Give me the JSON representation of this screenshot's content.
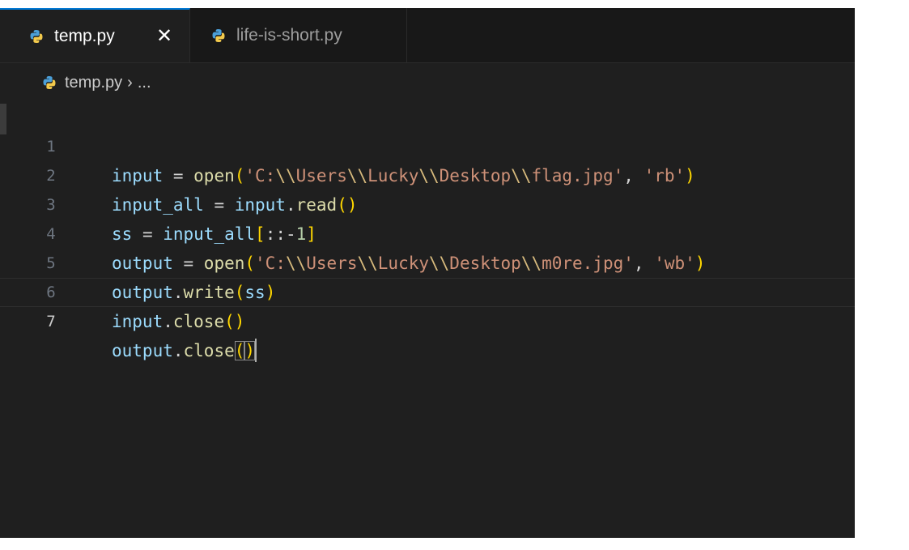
{
  "tabs": [
    {
      "label": "temp.py",
      "active": true,
      "close_icon": "close-icon"
    },
    {
      "label": "life-is-short.py",
      "active": false
    }
  ],
  "breadcrumb": {
    "file": "temp.py",
    "separator": "›",
    "symbol": "..."
  },
  "code": {
    "line_numbers": [
      "1",
      "2",
      "3",
      "4",
      "5",
      "6",
      "7"
    ],
    "current_line": 7,
    "lines": [
      {
        "input": "input",
        "eq": " = ",
        "open": "open",
        "lparen": "(",
        "s_start": "'C:",
        "e1": "\\\\",
        "s1": "Users",
        "e2": "\\\\",
        "s2": "Lucky",
        "e3": "\\\\",
        "s3": "Desktop",
        "e4": "\\\\",
        "s4": "flag.jpg'",
        "comma": ", ",
        "mode": "'rb'",
        "rparen": ")"
      },
      {
        "input_all": "input_all",
        "eq": " = ",
        "input": "input",
        "dot": ".",
        "read": "read",
        "parens": "()"
      },
      {
        "ss": "ss",
        "eq": " = ",
        "input_all": "input_all",
        "lbr": "[",
        "slice": "::-",
        "one": "1",
        "rbr": "]"
      },
      {
        "output": "output",
        "eq": " = ",
        "open": "open",
        "lparen": "(",
        "s_start": "'C:",
        "e1": "\\\\",
        "s1": "Users",
        "e2": "\\\\",
        "s2": "Lucky",
        "e3": "\\\\",
        "s3": "Desktop",
        "e4": "\\\\",
        "s4": "m0re.jpg'",
        "comma": ", ",
        "mode": "'wb'",
        "rparen": ")"
      },
      {
        "output": "output",
        "dot": ".",
        "write": "write",
        "lparen": "(",
        "ss": "ss",
        "rparen": ")"
      },
      {
        "input": "input",
        "dot": ".",
        "close": "close",
        "parens": "()"
      },
      {
        "output": "output",
        "dot": ".",
        "close": "close",
        "lparen": "(",
        "rparen": ")"
      }
    ]
  },
  "colors": {
    "editor_bg": "#1f1f1f",
    "tab_bar_bg": "#181818",
    "active_tab_accent": "#0078d4",
    "variable": "#9cdcfe",
    "function": "#dcdcaa",
    "string": "#ce9178",
    "escape": "#d7ba7d",
    "bracket": "#ffd700"
  }
}
